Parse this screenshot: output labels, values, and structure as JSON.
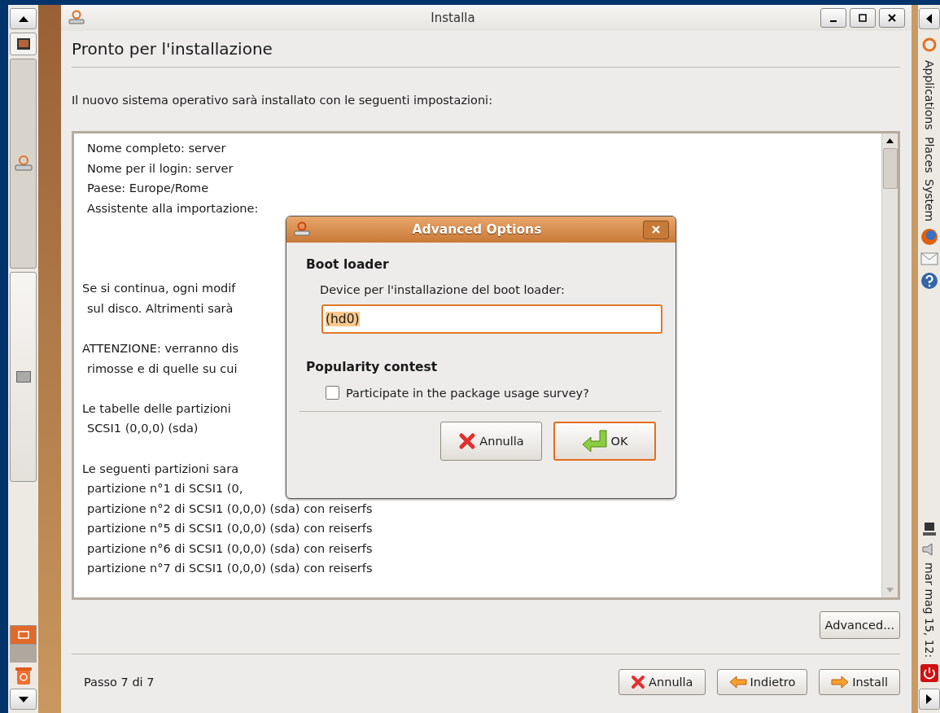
{
  "window": {
    "title": "Installa",
    "heading": "Pronto per l'installazione",
    "intro": "Il nuovo sistema operativo sarà installato con le seguenti impostazioni:"
  },
  "summary_paragraphs": [
    [
      "Nome completo: server",
      "Nome per il login: server",
      "Paese: Europe/Rome",
      "Assistente alla importazione:"
    ],
    [
      "Se si continua, ogni modif",
      "sul disco. Altrimenti sarà"
    ],
    [
      "ATTENZIONE: verranno dis",
      "rimosse e di quelle su cui"
    ],
    [
      "Le tabelle delle partizioni",
      "SCSI1 (0,0,0) (sda)"
    ],
    [
      "Le seguenti partizioni sara",
      "partizione n°1 di SCSI1 (0,",
      "partizione n°2 di SCSI1 (0,0,0) (sda) con reiserfs",
      "partizione n°5 di SCSI1 (0,0,0) (sda) con reiserfs",
      "partizione n°6 di SCSI1 (0,0,0) (sda) con reiserfs",
      "partizione n°7 di SCSI1 (0,0,0) (sda) con reiserfs"
    ]
  ],
  "advanced_button": "Advanced...",
  "step": "Passo 7 di 7",
  "footer_buttons": [
    {
      "label": "Annulla"
    },
    {
      "label": "Indietro"
    },
    {
      "label": "Install"
    }
  ],
  "dialog": {
    "title": "Advanced Options",
    "boot_section": "Boot loader",
    "device_label": "Device per l'installazione del boot loader:",
    "device_value": "(hd0)",
    "popularity_section": "Popularity contest",
    "survey_label": "Participate in the package usage survey?",
    "survey_checked": false,
    "buttons": [
      {
        "label": "Annulla",
        "kind": "normal"
      },
      {
        "label": "OK",
        "kind": "default"
      }
    ]
  },
  "top_panel": {
    "menus": [
      "Applications",
      "Places",
      "System"
    ],
    "clock": "mar mag 15, 12:"
  }
}
